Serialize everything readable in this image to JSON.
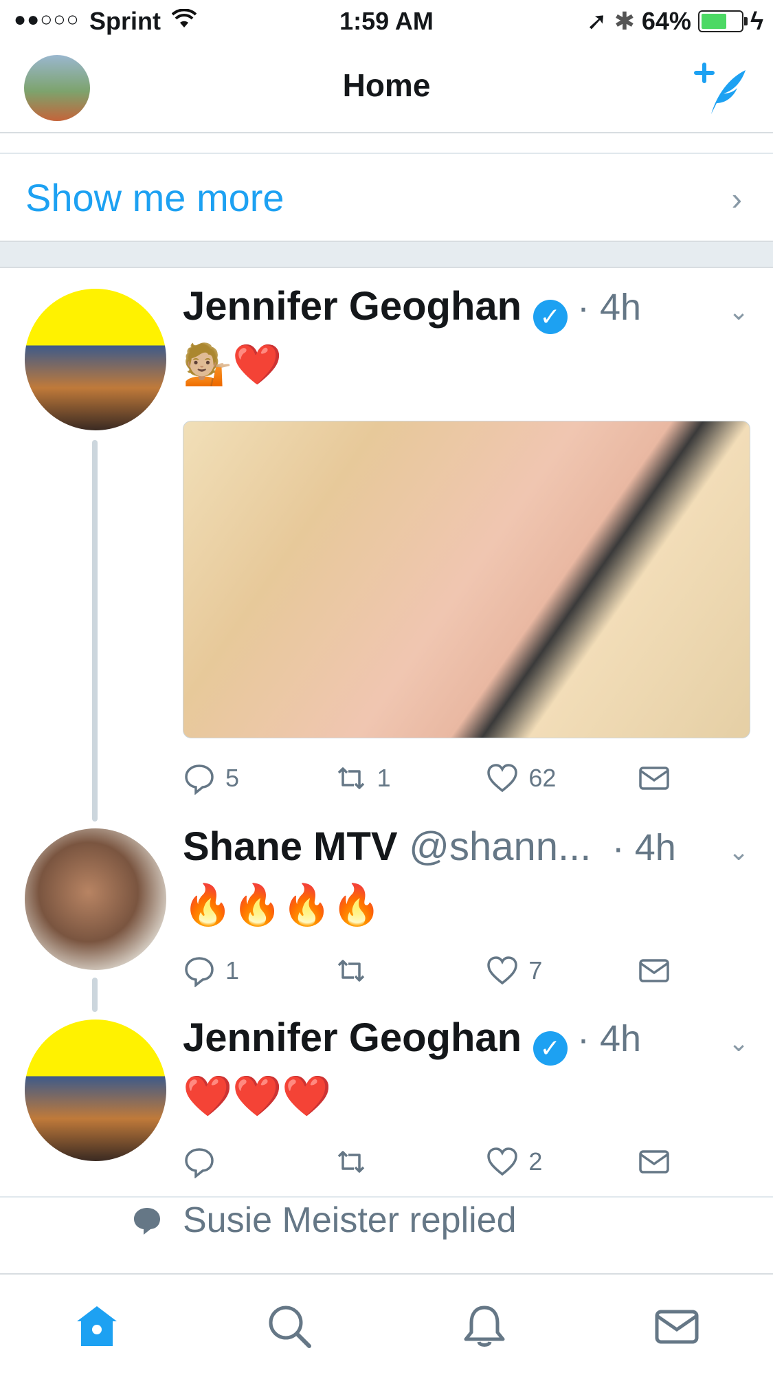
{
  "status_bar": {
    "signal": "●●○○○",
    "carrier": "Sprint",
    "time": "1:59 AM",
    "battery": "64%",
    "battery_level": 0.64
  },
  "header": {
    "title": "Home",
    "compose_icon": "compose-tweet-icon",
    "avatar_icon": "profile-avatar"
  },
  "show_more": {
    "label": "Show me more",
    "chevron": "›"
  },
  "tweets": [
    {
      "name": "Jennifer Geoghan",
      "verified": true,
      "handle": "",
      "time": "· 4h",
      "text": "💁🏼❤️",
      "has_media": true,
      "replies": "5",
      "retweets": "1",
      "likes": "62"
    },
    {
      "name": "Shane MTV",
      "verified": false,
      "handle": "@shann...",
      "time": "· 4h",
      "text": "🔥🔥🔥🔥",
      "has_media": false,
      "replies": "1",
      "retweets": "",
      "likes": "7"
    },
    {
      "name": "Jennifer Geoghan",
      "verified": true,
      "handle": "",
      "time": "· 4h",
      "text": "❤️❤️❤️",
      "has_media": false,
      "replies": "",
      "retweets": "",
      "likes": "2"
    }
  ],
  "social_context": {
    "text": "Susie Meister replied"
  },
  "tabs": [
    {
      "name": "home",
      "icon": "home-icon",
      "active": true
    },
    {
      "name": "search",
      "icon": "search-icon",
      "active": false
    },
    {
      "name": "notifications",
      "icon": "bell-icon",
      "active": false
    },
    {
      "name": "messages",
      "icon": "mail-icon",
      "active": false
    }
  ],
  "colors": {
    "accent": "#1da1f2",
    "secondary_text": "#657786",
    "divider": "#e1e8ed"
  }
}
